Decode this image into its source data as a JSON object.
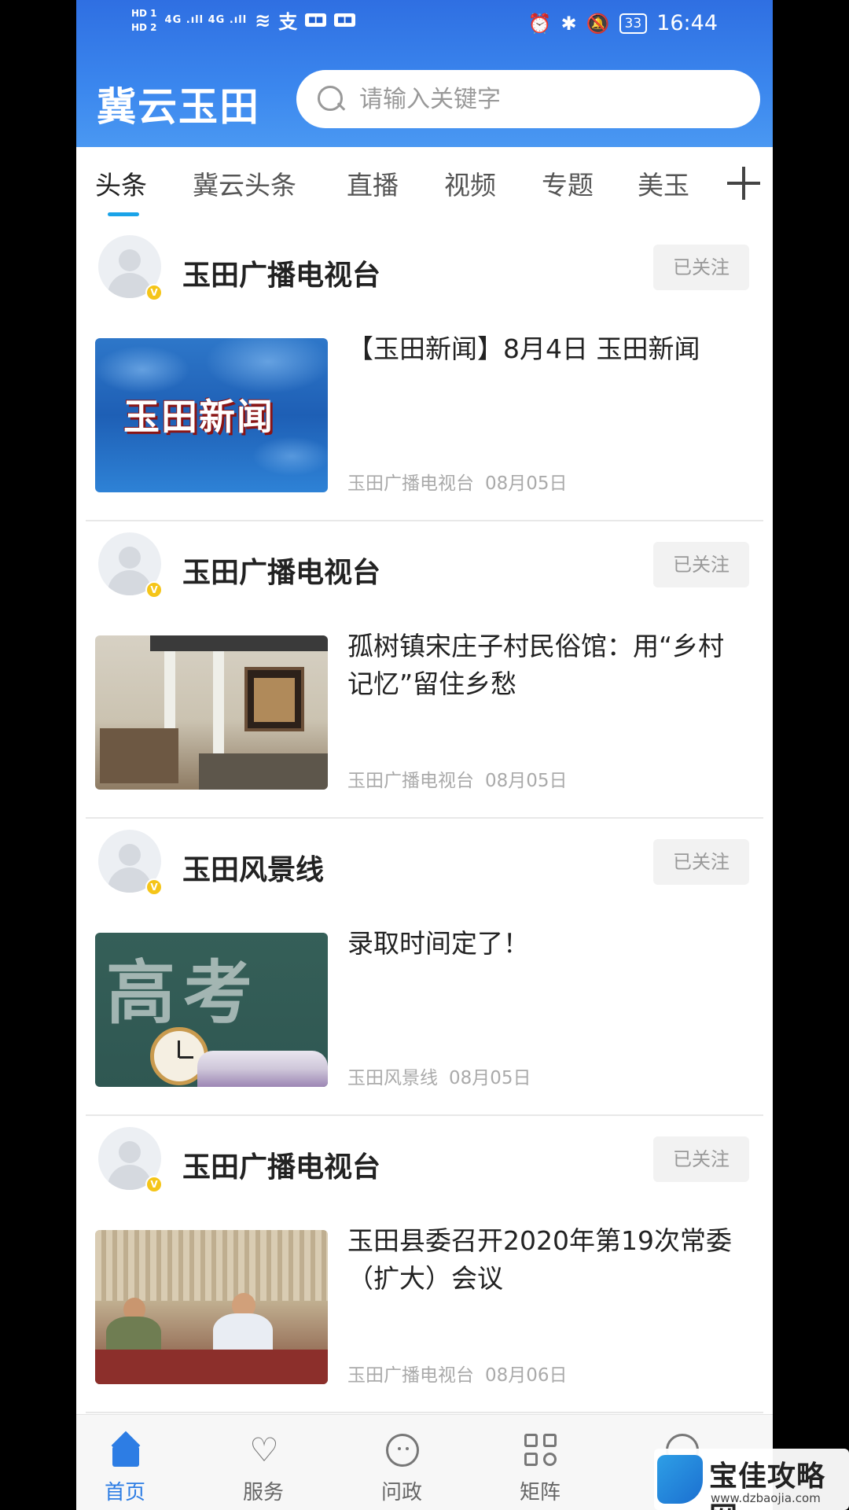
{
  "status_bar": {
    "hd1": "HD 1",
    "hd2": "HD 2",
    "signal": "4G .ıll 4G .ıll",
    "time": "16:44",
    "battery": "33"
  },
  "header": {
    "brand": "冀云玉田",
    "search_placeholder": "请输入关键字"
  },
  "tabs": [
    "头条",
    "冀云头条",
    "直播",
    "视频",
    "专题",
    "美玉"
  ],
  "cards": [
    {
      "source": "玉田广播电视台",
      "follow_label": "已关注",
      "verified": "V",
      "thumb_text": "玉田新闻",
      "headline": "【玉田新闻】8月4日 玉田新闻",
      "meta_source": "玉田广播电视台",
      "date": "08月05日"
    },
    {
      "source": "玉田广播电视台",
      "follow_label": "已关注",
      "verified": "V",
      "headline": "孤树镇宋庄子村民俗馆：用“乡村记忆”留住乡愁",
      "meta_source": "玉田广播电视台",
      "date": "08月05日"
    },
    {
      "source": "玉田风景线",
      "follow_label": "已关注",
      "verified": "V",
      "thumb_text": "高考",
      "headline": "录取时间定了！",
      "meta_source": "玉田风景线",
      "date": "08月05日"
    },
    {
      "source": "玉田广播电视台",
      "follow_label": "已关注",
      "verified": "V",
      "headline": "玉田县委召开2020年第19次常委（扩大）会议",
      "meta_source": "玉田广播电视台",
      "date": "08月06日"
    }
  ],
  "bottom_nav": [
    "首页",
    "服务",
    "问政",
    "矩阵"
  ],
  "watermark": {
    "text": "宝佳攻略网",
    "url": "www.dzbaojia.com"
  },
  "colors": {
    "header_blue": "#2f6fe2",
    "tab_indicator": "#1aa3e8",
    "nav_active": "#2d7de4"
  }
}
